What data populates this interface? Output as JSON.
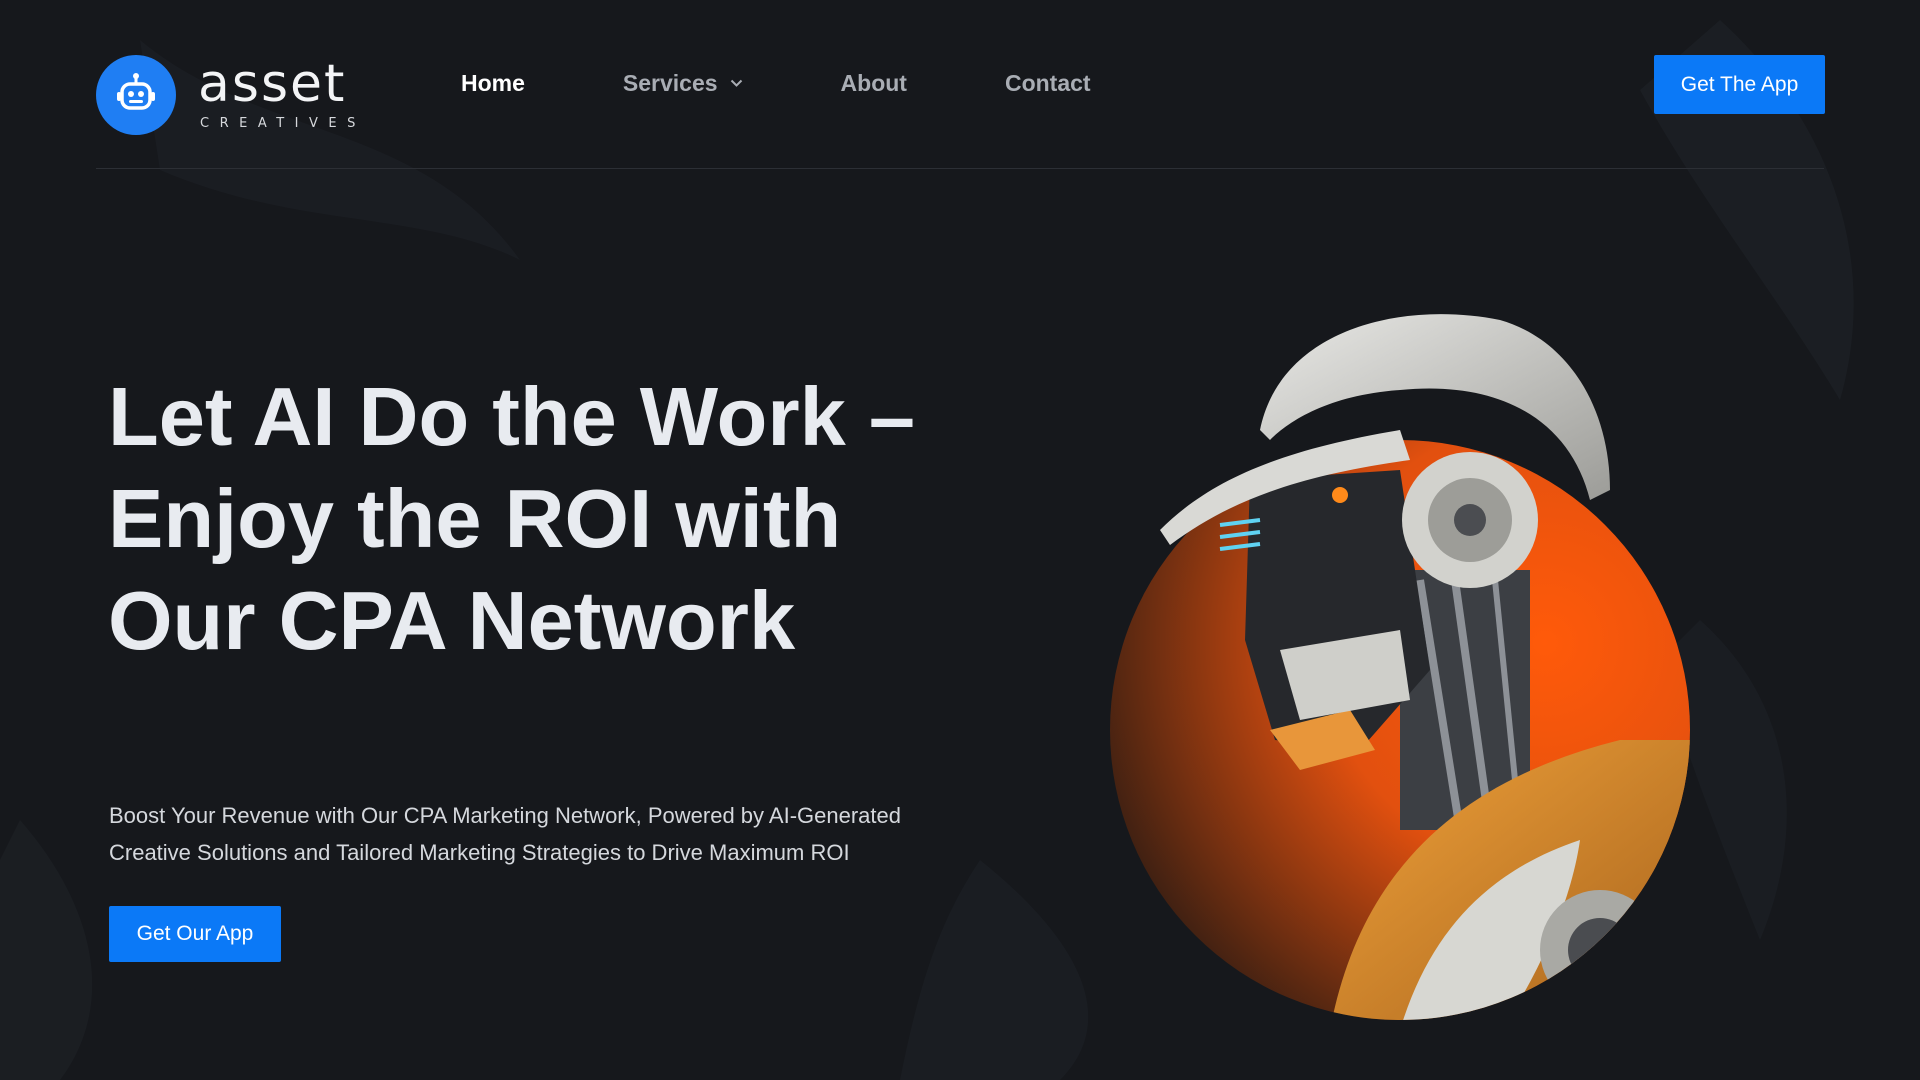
{
  "brand": {
    "name": "asset",
    "tagline": "CREATIVES",
    "logo_icon": "robot-icon",
    "accent": "#0b79f7"
  },
  "nav": {
    "items": [
      {
        "label": "Home",
        "active": true
      },
      {
        "label": "Services",
        "has_dropdown": true,
        "icon": "chevron-down-icon"
      },
      {
        "label": "About"
      },
      {
        "label": "Contact"
      }
    ]
  },
  "header": {
    "cta_label": "Get The App"
  },
  "hero": {
    "title": "Let AI Do the Work – Enjoy the ROI with Our CPA Network",
    "subtitle": "Boost Your Revenue with Our CPA Marketing Network, Powered by AI-Generated Creative Solutions and Tailored Marketing Strategies to Drive Maximum ROI",
    "cta_label": "Get Our App",
    "illustration_accent": "#ef5a12"
  },
  "colors": {
    "background": "#16181c",
    "text": "#e8ebf0",
    "nav_muted": "#a9adb4"
  }
}
